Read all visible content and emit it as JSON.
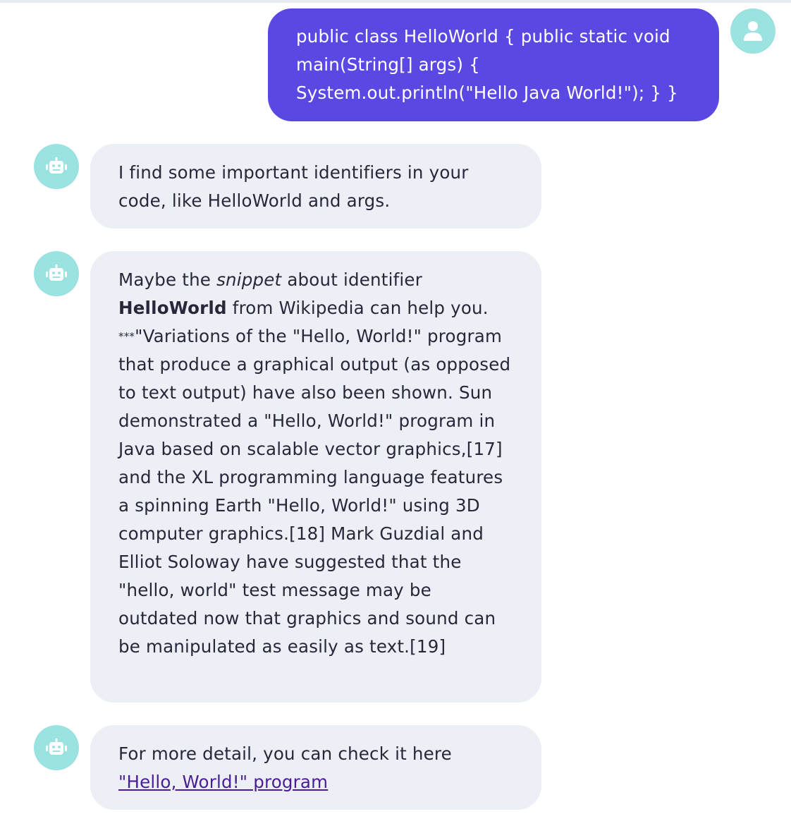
{
  "messages": {
    "user_1": {
      "text": "public class HelloWorld { public static void main(String[] args) { System.out.println(\"Hello Java World!\"); } }"
    },
    "bot_1": {
      "text": "I find some important identifiers in your code, like HelloWorld and args."
    },
    "bot_2": {
      "part1": "Maybe the ",
      "em": "snippet",
      "part2": " about identifier ",
      "strong": "HelloWorld",
      "part3": " from Wikipedia can help you.",
      "stars": "***",
      "quote": "\"Variations of the \"Hello, World!\" program that produce a graphical output (as opposed to text output) have also been shown. Sun demonstrated a \"Hello, World!\" program in Java based on scalable vector graphics,[17] and the XL programming language features a spinning Earth \"Hello, World!\" using 3D computer graphics.[18] Mark Guzdial and Elliot Soloway have suggested that the \"hello, world\" test message may be outdated now that graphics and sound can be manipulated as easily as text.[19]"
    },
    "bot_3": {
      "prefix": "For more detail, you can check it here ",
      "link_text": "\"Hello, World!\" program"
    }
  },
  "icons": {
    "user_avatar": "user-icon",
    "bot_avatar": "robot-icon"
  },
  "colors": {
    "user_bubble": "#5b48e3",
    "bot_bubble": "#edeff6",
    "avatar": "#9ae3e0",
    "link": "#4a1d96"
  }
}
